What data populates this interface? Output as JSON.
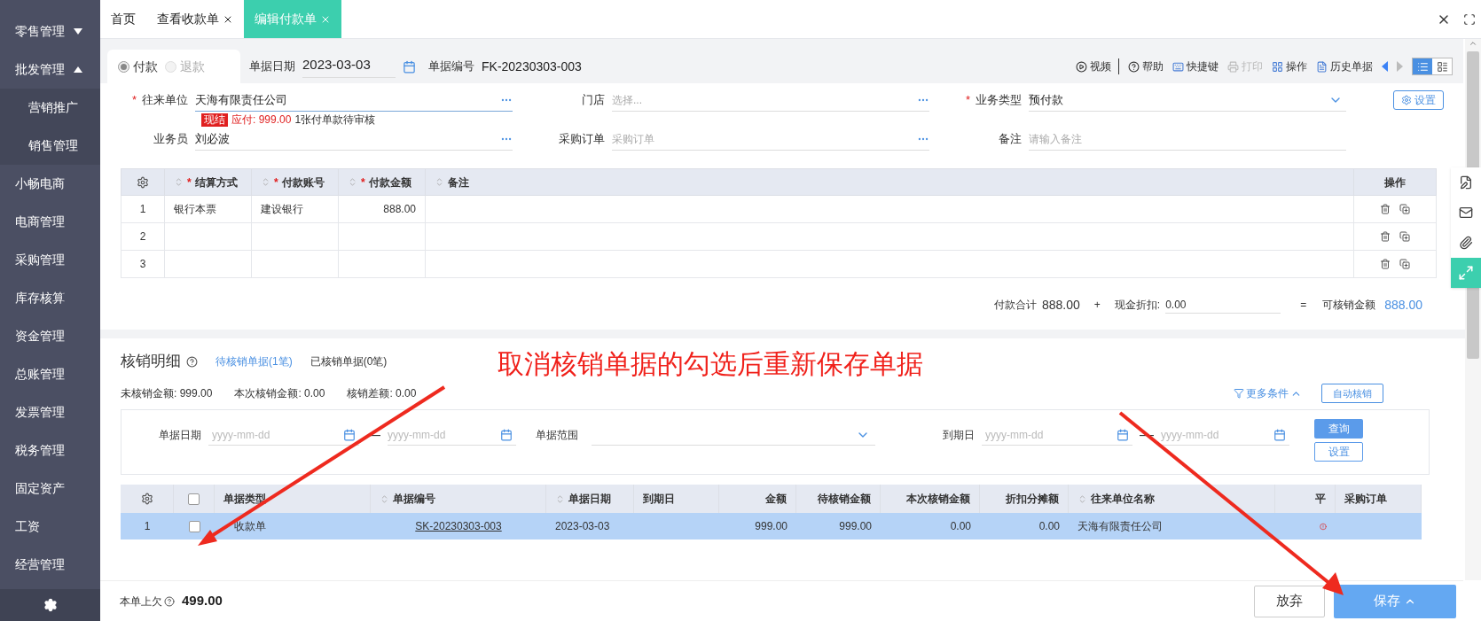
{
  "sidebar": {
    "items": [
      {
        "label": "零售管理",
        "expanded": false
      },
      {
        "label": "批发管理",
        "expanded": true,
        "children": [
          {
            "label": "营销推广"
          },
          {
            "label": "销售管理"
          }
        ]
      },
      {
        "label": "小畅电商"
      },
      {
        "label": "电商管理"
      },
      {
        "label": "采购管理"
      },
      {
        "label": "库存核算"
      },
      {
        "label": "资金管理"
      },
      {
        "label": "总账管理"
      },
      {
        "label": "发票管理"
      },
      {
        "label": "税务管理"
      },
      {
        "label": "固定资产"
      },
      {
        "label": "工资"
      },
      {
        "label": "经营管理"
      }
    ]
  },
  "tabs": [
    {
      "label": "首页",
      "selected": false,
      "closable": false
    },
    {
      "label": "查看收款单",
      "selected": false,
      "closable": true
    },
    {
      "label": "编辑付款单",
      "selected": true,
      "closable": true
    }
  ],
  "toolbar": {
    "direction": [
      {
        "label": "付款",
        "selected": true
      },
      {
        "label": "退款",
        "selected": false
      }
    ],
    "date_label": "单据日期",
    "date": "2023-03-03",
    "number_label": "单据编号",
    "number": "FK-20230303-003",
    "actions": [
      {
        "kind": "video",
        "label": "视频",
        "disabled": false
      },
      {
        "kind": "help",
        "label": "帮助",
        "disabled": false
      },
      {
        "kind": "shortcut",
        "label": "快捷键",
        "disabled": false
      },
      {
        "kind": "print",
        "label": "打印",
        "disabled": true
      },
      {
        "kind": "ops",
        "label": "操作",
        "disabled": false
      },
      {
        "kind": "history",
        "label": "历史单据",
        "disabled": false
      }
    ],
    "views": [
      {
        "kind": "list",
        "selected": true
      },
      {
        "kind": "card",
        "selected": false
      }
    ]
  },
  "form": {
    "fields": [
      {
        "kind": "lookup",
        "required_mark": "*",
        "label": "往来单位",
        "value": "天海有限责任公司"
      },
      {
        "kind": "lookup",
        "label": "门店",
        "placeholder": "选择..."
      },
      {
        "kind": "select",
        "required_mark": "*",
        "label": "业务类型",
        "value": "预付款"
      },
      {
        "kind": "lookup",
        "label": "业务员",
        "value": "刘必波"
      },
      {
        "kind": "lookup",
        "label": "采购订单",
        "placeholder": "采购订单"
      },
      {
        "kind": "text",
        "label": "备注",
        "placeholder": "请输入备注"
      }
    ],
    "notice": {
      "badge": "现结",
      "due": "应付: 999.00",
      "text": "1张付单款待审核"
    },
    "settings_button": "设置"
  },
  "lines_table": {
    "columns": [
      {
        "required_mark": "*",
        "label": "结算方式"
      },
      {
        "required_mark": "*",
        "label": "付款账号"
      },
      {
        "required_mark": "*",
        "label": "付款金额"
      },
      {
        "label": "备注"
      }
    ],
    "action_column": "操作",
    "rows": [
      {
        "no": "1",
        "method": "银行本票",
        "account": "建设银行",
        "amount": "888.00"
      },
      {
        "no": "2"
      },
      {
        "no": "3"
      }
    ]
  },
  "totals": {
    "total_label": "付款合计",
    "total": "888.00",
    "plus": "+",
    "discount_label": "现金折扣:",
    "discount": "0.00",
    "equals": "=",
    "available_label": "可核销金额",
    "available": "888.00"
  },
  "verification": {
    "title": "核销明细",
    "tabs": [
      {
        "label": "待核销单据(1笔)",
        "selected": true
      },
      {
        "label": "已核销单据(0笔)",
        "selected": false
      }
    ],
    "summary": [
      "未核销金额: 999.00",
      "本次核销金额: 0.00",
      "核销差额: 0.00"
    ],
    "more_conditions": "更多条件",
    "auto_button": "自动核销",
    "filters": {
      "ranges": [
        {
          "label": "单据日期",
          "from_placeholder": "yyyy-mm-dd",
          "dash": "—",
          "to_placeholder": "yyyy-mm-dd"
        },
        {
          "label": "到期日",
          "from_placeholder": "yyyy-mm-dd",
          "dash": "—",
          "to_placeholder": "yyyy-mm-dd"
        }
      ],
      "range_label": "单据范围",
      "query_button": "查询",
      "settings_button": "设置"
    },
    "table": {
      "header_checked": false,
      "columns": [
        {
          "label": "单据类型",
          "sortable": false
        },
        {
          "label": "单据编号",
          "sortable": true
        },
        {
          "label": "单据日期",
          "sortable": true
        },
        {
          "label": "到期日",
          "sortable": false
        },
        {
          "label": "金额",
          "sortable": false
        },
        {
          "label": "待核销金额",
          "sortable": false
        },
        {
          "label": "本次核销金额",
          "sortable": false
        },
        {
          "label": "折扣分摊额",
          "sortable": false
        },
        {
          "label": "往来单位名称",
          "sortable": true
        },
        {
          "label": "平",
          "sortable": false
        },
        {
          "label": "采购订单",
          "sortable": false
        }
      ],
      "rows": [
        {
          "no": "1",
          "checked": false,
          "selected": true,
          "type": "收款单",
          "number": "SK-20230303-003",
          "date": "2023-03-03",
          "amount": "999.00",
          "pending": "999.00",
          "current": "0.00",
          "discount": "0.00",
          "partner": "天海有限责任公司",
          "unbalanced": true
        }
      ]
    }
  },
  "footer": {
    "owed_label": "本单上欠",
    "owed": "499.00",
    "discard_button": "放弃",
    "save_button": "保存"
  },
  "annotation": {
    "text": "取消核销单据的勾选后重新保存单据"
  }
}
